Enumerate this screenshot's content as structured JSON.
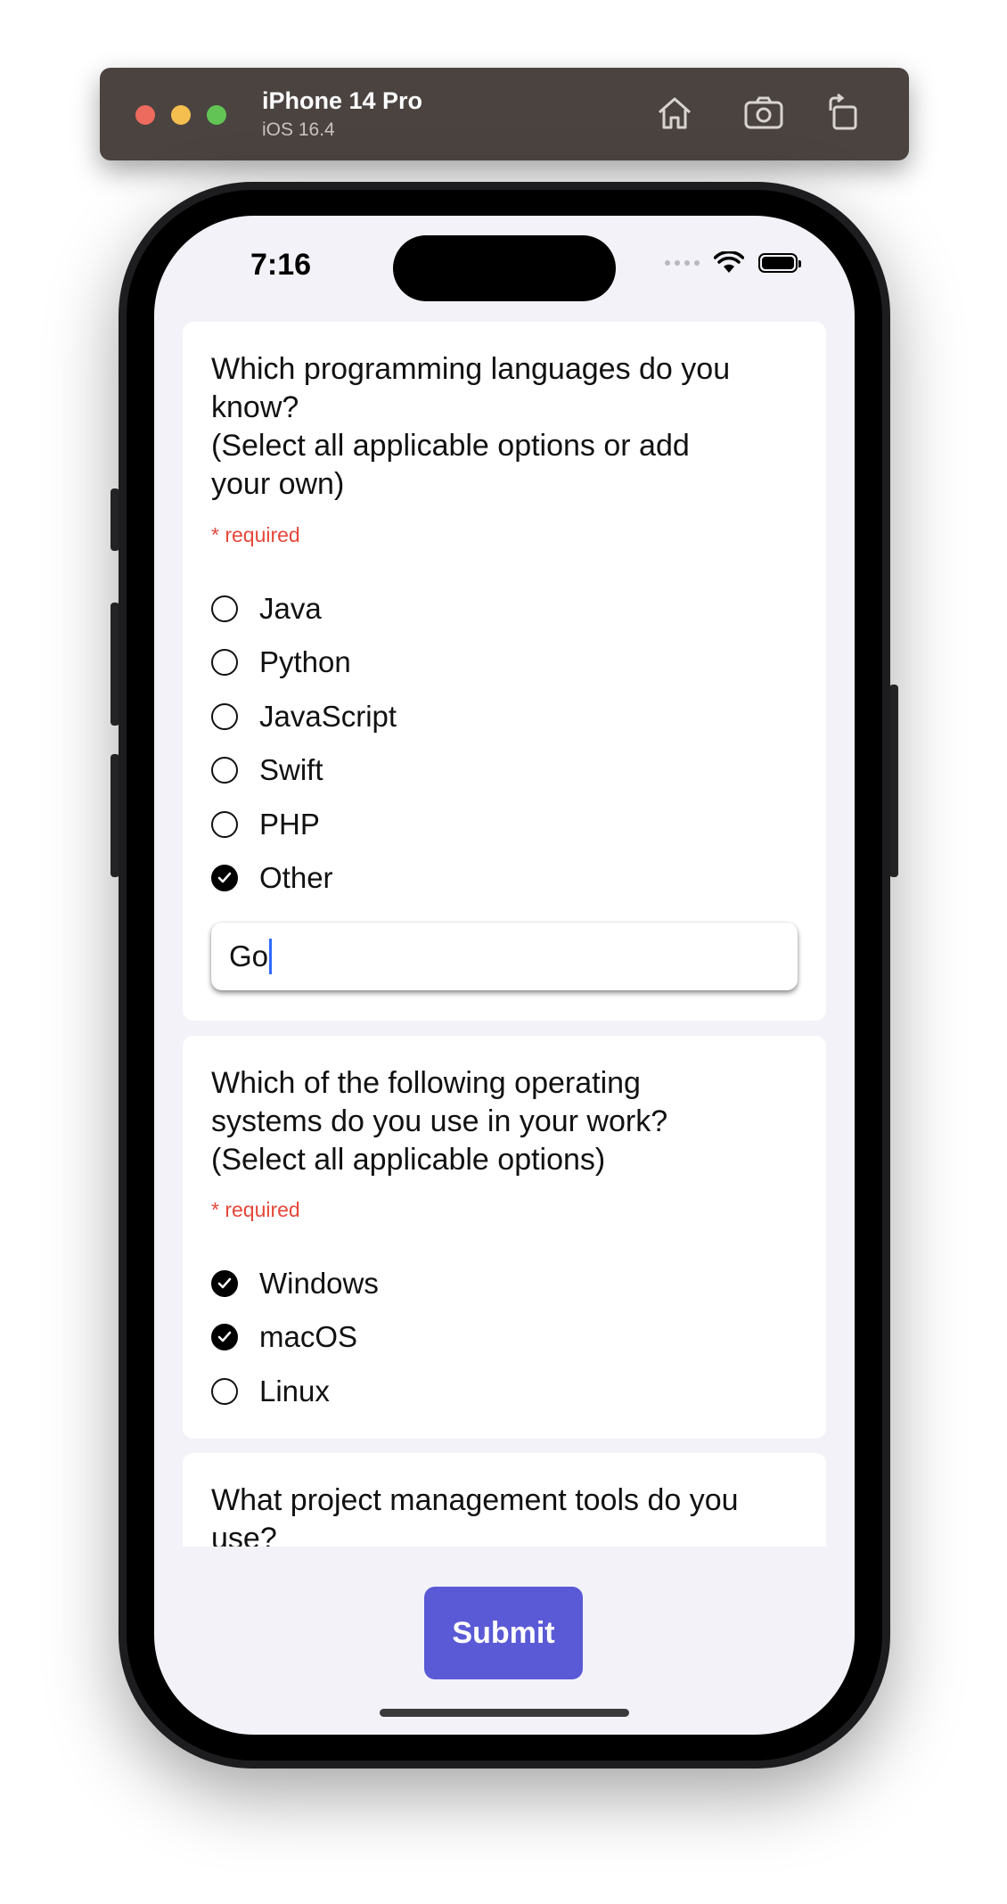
{
  "simulator": {
    "device_name": "iPhone 14 Pro",
    "os_version": "iOS 16.4",
    "icons": [
      "home-icon",
      "screenshot-icon",
      "rotate-icon"
    ]
  },
  "status_bar": {
    "time": "7:16",
    "icons": [
      "cellular-signal-icon",
      "wifi-icon",
      "battery-icon"
    ]
  },
  "questions": [
    {
      "title": "Which programming languages do you know?\n(Select all applicable options or add your own)",
      "required_label": "* required",
      "options": [
        {
          "label": "Java",
          "checked": false
        },
        {
          "label": "Python",
          "checked": false
        },
        {
          "label": "JavaScript",
          "checked": false
        },
        {
          "label": "Swift",
          "checked": false
        },
        {
          "label": "PHP",
          "checked": false
        },
        {
          "label": "Other",
          "checked": true
        }
      ],
      "other_input_value": "Go"
    },
    {
      "title": "Which of the following operating systems do you use in your work?\n(Select all applicable options)",
      "required_label": "* required",
      "options": [
        {
          "label": "Windows",
          "checked": true
        },
        {
          "label": "macOS",
          "checked": true
        },
        {
          "label": "Linux",
          "checked": false
        }
      ]
    },
    {
      "title": "What project management tools do you use?"
    }
  ],
  "submit_label": "Submit",
  "colors": {
    "accent": "#5a5ad6",
    "required": "#e5473a",
    "background": "#f2f2f8"
  }
}
